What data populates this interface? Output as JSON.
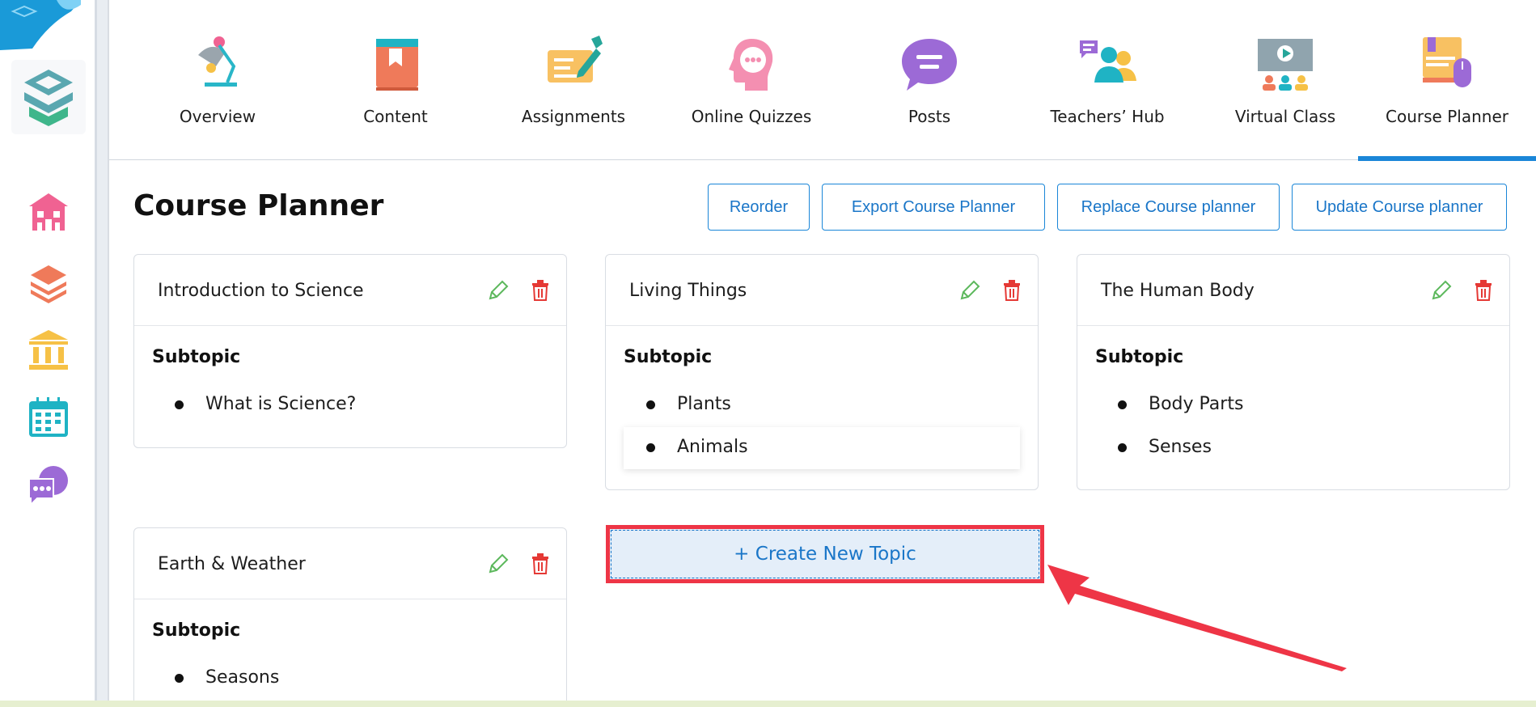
{
  "tabs": [
    {
      "label": "Overview",
      "icon": "desk-lamp-icon"
    },
    {
      "label": "Content",
      "icon": "book-icon"
    },
    {
      "label": "Assignments",
      "icon": "pen-paper-icon"
    },
    {
      "label": "Online Quizzes",
      "icon": "head-thought-icon"
    },
    {
      "label": "Posts",
      "icon": "chat-bubble-icon"
    },
    {
      "label": "Teachers’ Hub",
      "icon": "people-group-icon"
    },
    {
      "label": "Virtual Class",
      "icon": "video-board-icon"
    },
    {
      "label": "Course Planner",
      "icon": "planner-mouse-icon"
    }
  ],
  "active_tab": "Course Planner",
  "page": {
    "title": "Course Planner"
  },
  "toolbar": {
    "reorder": "Reorder",
    "export": "Export Course Planner",
    "replace": "Replace Course planner",
    "update": "Update Course planner"
  },
  "topics": [
    {
      "title": "Introduction to Science",
      "subtopic_label": "Subtopic",
      "subtopics": [
        "What is Science?"
      ]
    },
    {
      "title": "Living Things",
      "subtopic_label": "Subtopic",
      "subtopics": [
        "Plants",
        "Animals"
      ]
    },
    {
      "title": "The Human Body",
      "subtopic_label": "Subtopic",
      "subtopics": [
        "Body Parts",
        "Senses"
      ]
    },
    {
      "title": "Earth & Weather",
      "subtopic_label": "Subtopic",
      "subtopics": [
        "Seasons"
      ]
    }
  ],
  "create_topic": "+ Create New Topic",
  "colors": {
    "accent": "#1a86d8",
    "highlight": "#ee3546",
    "edit": "#5cb85c",
    "delete": "#e53935"
  }
}
